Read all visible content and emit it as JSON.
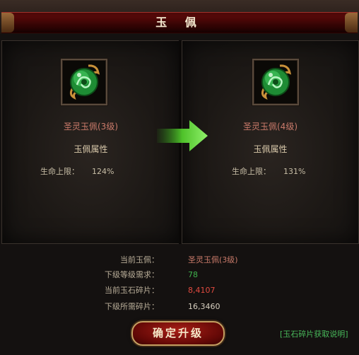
{
  "title": "玉 佩",
  "current": {
    "name": "圣灵玉佩(3级)",
    "attrs_label": "玉佩属性",
    "stat_label": "生命上限：",
    "stat_value": "124%"
  },
  "next": {
    "name": "圣灵玉佩(4级)",
    "attrs_label": "玉佩属性",
    "stat_label": "生命上限：",
    "stat_value": "131%"
  },
  "info": {
    "current_jade_label": "当前玉佩：",
    "current_jade_value": "圣灵玉佩(3级)",
    "level_req_label": "下级等级需求：",
    "level_req_value": "78",
    "current_frag_label": "当前玉石碎片：",
    "current_frag_value": "8,4107",
    "needed_frag_label": "下级所需碎片：",
    "needed_frag_value": "16,3460"
  },
  "upgrade_button": "确定升级",
  "help_link": "[玉石碎片获取说明]",
  "icons": [
    "jade-pendant-icon",
    "jade-pendant-icon",
    "right-arrow-icon"
  ],
  "colors": {
    "item_name": "#c97a6a",
    "level_req": "#3fb34d",
    "current_frag": "#e04a3f",
    "needed_frag": "#d8d0c0",
    "help_link": "#48b85a"
  }
}
